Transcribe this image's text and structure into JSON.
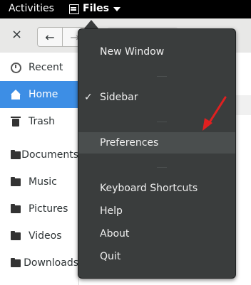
{
  "topbar": {
    "activities": "Activities",
    "app_menu": "Files"
  },
  "window": {
    "close_glyph": "×",
    "back_glyph": "←",
    "forward_glyph": "→"
  },
  "sidebar": {
    "items": [
      {
        "label": "Recent",
        "icon": "clock-icon"
      },
      {
        "label": "Home",
        "icon": "home-icon",
        "active": true
      },
      {
        "label": "Trash",
        "icon": "trash-icon"
      },
      {
        "label": "Documents",
        "icon": "folder-icon"
      },
      {
        "label": "Music",
        "icon": "folder-icon"
      },
      {
        "label": "Pictures",
        "icon": "folder-icon"
      },
      {
        "label": "Videos",
        "icon": "folder-icon"
      },
      {
        "label": "Downloads",
        "icon": "folder-icon"
      }
    ]
  },
  "menu": {
    "items": [
      {
        "label": "New Window"
      },
      {
        "label": "Sidebar",
        "checked": true,
        "check_glyph": "✓"
      },
      {
        "label": "Preferences",
        "highlighted": true
      },
      {
        "label": "Keyboard Shortcuts"
      },
      {
        "label": "Help"
      },
      {
        "label": "About"
      },
      {
        "label": "Quit"
      }
    ]
  },
  "colors": {
    "accent": "#3d8ee5",
    "menu_bg": "#3a3d3d",
    "annotation_arrow": "#e02020"
  }
}
